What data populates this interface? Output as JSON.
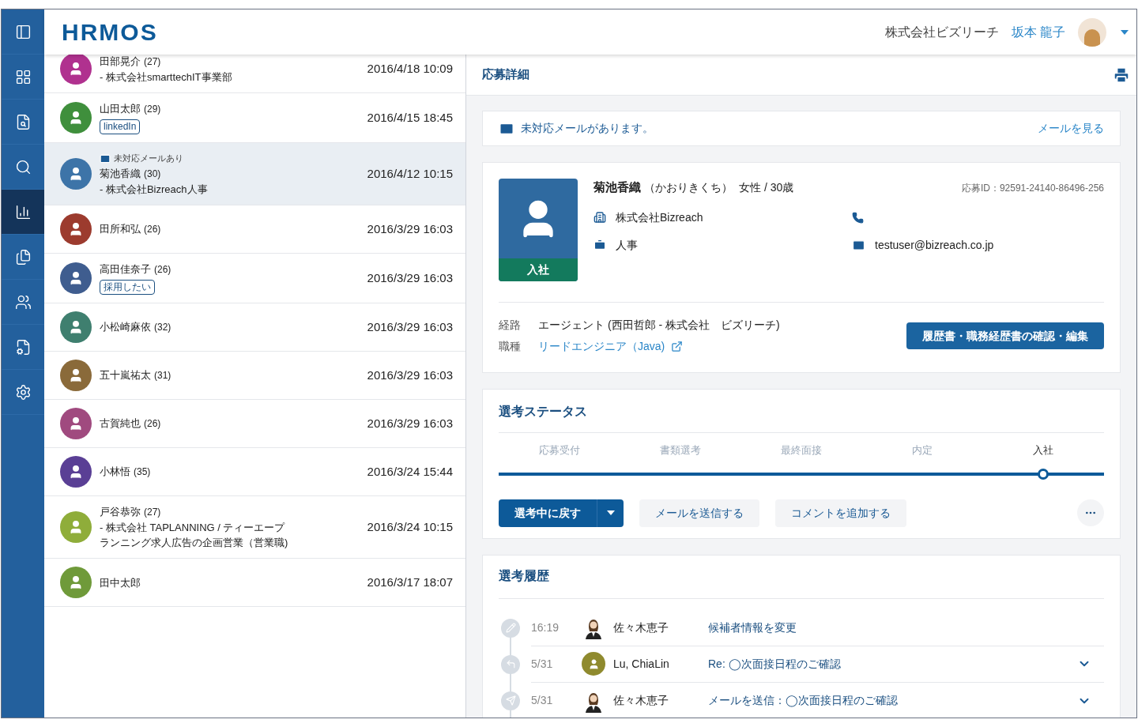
{
  "sidebar": {
    "items": [
      {
        "selected": false
      },
      {
        "selected": false
      },
      {
        "selected": false
      },
      {
        "selected": true
      },
      {
        "selected": false
      },
      {
        "selected": false
      },
      {
        "selected": false
      },
      {
        "selected": false
      }
    ]
  },
  "header": {
    "logo": "HRMOS",
    "company": "株式会社ビズリーチ",
    "user": "坂本 龍子"
  },
  "candidates": [
    {
      "name": "田部晃介",
      "age": "(27)",
      "detail": "- 株式会社smarttechIT事業部",
      "date": "2016/4/18 10:09",
      "color": "#b0318f",
      "selected": false
    },
    {
      "name": "山田太郎",
      "age": "(29)",
      "tag": "linkedIn",
      "date": "2016/4/15 18:45",
      "color": "#3f8f3c",
      "selected": false
    },
    {
      "notice": "未対応メールあり",
      "name": "菊池香織",
      "age": "(30)",
      "detail": "- 株式会社Bizreach人事",
      "date": "2016/4/12 10:15",
      "color": "#3d74a8",
      "selected": true
    },
    {
      "name": "田所和弘",
      "age": "(26)",
      "date": "2016/3/29 16:03",
      "color": "#9c3b2e",
      "selected": false
    },
    {
      "name": "高田佳奈子",
      "age": "(26)",
      "tag": "採用したい",
      "date": "2016/3/29 16:03",
      "color": "#3f5d8f",
      "selected": false
    },
    {
      "name": "小松崎麻依",
      "age": "(32)",
      "date": "2016/3/29 16:03",
      "color": "#3f7f6f",
      "selected": false
    },
    {
      "name": "五十嵐祐太",
      "age": "(31)",
      "date": "2016/3/29 16:03",
      "color": "#8a6a3a",
      "selected": false
    },
    {
      "name": "古賀純也",
      "age": "(26)",
      "date": "2016/3/29 16:03",
      "color": "#a04a7f",
      "selected": false
    },
    {
      "name": "小林悟",
      "age": "(35)",
      "date": "2016/3/24 15:44",
      "color": "#5a3f95",
      "selected": false
    },
    {
      "name": "戸谷恭弥",
      "age": "(27)",
      "detail": "- 株式会社 TAPLANNING / ティーエープランニング求人広告の企画営業（営業職)",
      "date": "2016/3/24 10:15",
      "color": "#8fad3a",
      "selected": false
    },
    {
      "name": "田中太郎",
      "date": "2016/3/17 18:07",
      "color": "#6f9a3a",
      "selected": false
    }
  ],
  "detail": {
    "title": "応募詳細",
    "mail_notice": {
      "text": "未対応メールがあります。",
      "link": "メールを見る"
    },
    "profile": {
      "status": "入社",
      "name": "菊池香織",
      "kana": "（かおりきくち）",
      "gender_age": "女性 / 30歳",
      "application_id": "応募ID：92591-24140-86496-256",
      "company": "株式会社Bizreach",
      "department": "人事",
      "email": "testuser@bizreach.co.jp",
      "route_label": "経路",
      "route": "エージェント (西田哲郎 - 株式会社　ビズリーチ)",
      "job_label": "職種",
      "job": "リードエンジニア（Java)",
      "resume_button": "履歴書・職務経歴書の確認・編集"
    },
    "status": {
      "title": "選考ステータス",
      "stages": [
        {
          "label": "応募受付",
          "selected": false
        },
        {
          "label": "書類選考",
          "selected": false
        },
        {
          "label": "最終面接",
          "selected": false
        },
        {
          "label": "内定",
          "selected": false
        },
        {
          "label": "入社",
          "selected": true
        }
      ],
      "primary_button": "選考中に戻す",
      "buttons": [
        "メールを送信する",
        "コメントを追加する"
      ]
    },
    "history": {
      "title": "選考履歴",
      "entries": [
        {
          "kind": "edit",
          "time": "16:19",
          "person": "佐々木恵子",
          "photo": true,
          "text": "候補者情報を変更",
          "expandable": false
        },
        {
          "kind": "received",
          "time": "5/31",
          "person": "Lu, ChiaLin",
          "photo": false,
          "color": "#8f8a2e",
          "text": "Re: ◯次面接日程のご確認",
          "expandable": true
        },
        {
          "kind": "sent",
          "time": "5/31",
          "person": "佐々木恵子",
          "photo": true,
          "text": "メールを送信：◯次面接日程のご確認",
          "expandable": true
        }
      ]
    }
  }
}
